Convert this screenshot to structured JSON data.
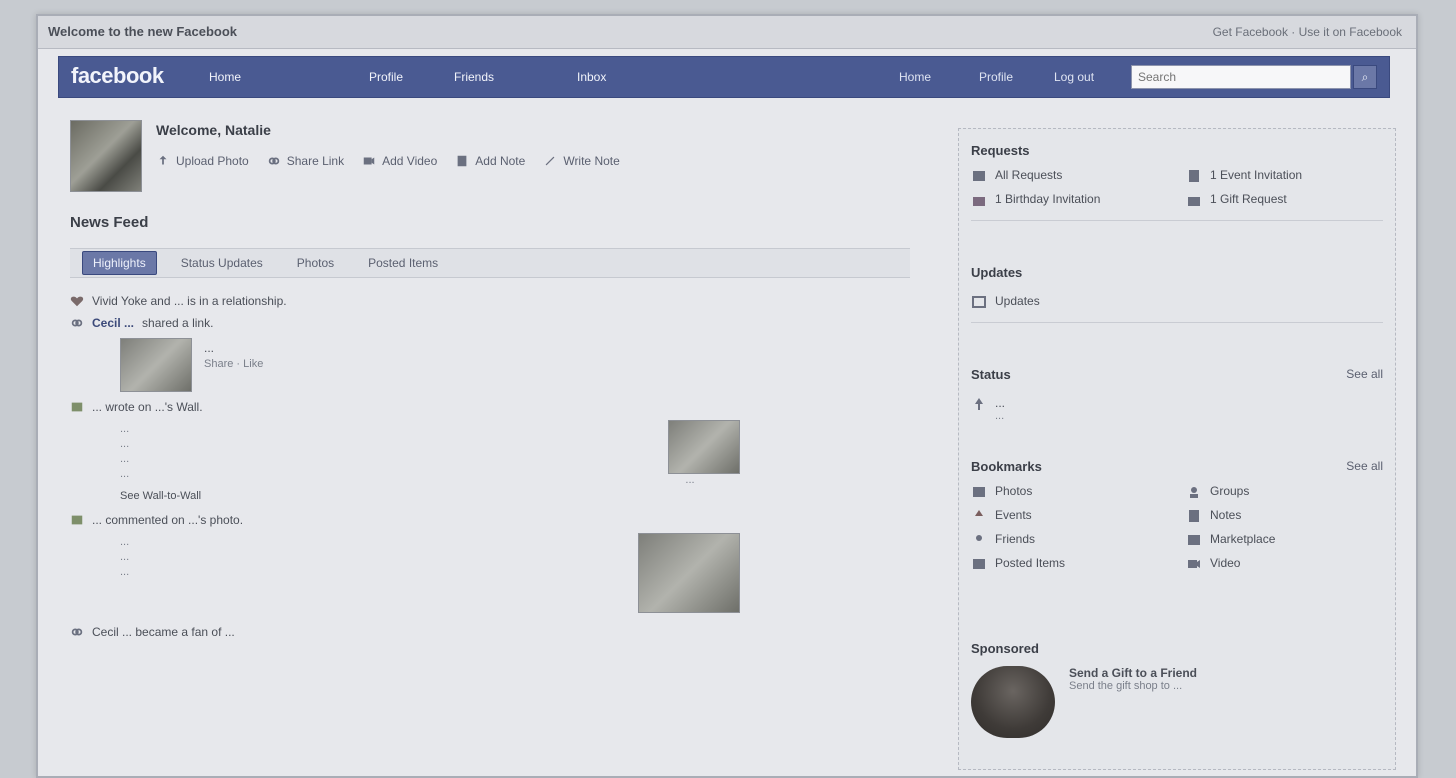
{
  "window": {
    "title": "Welcome to the new Facebook",
    "right_text": "Get Facebook · Use it on Facebook"
  },
  "topnav": {
    "logo": "facebook",
    "links": [
      "Home",
      "Profile",
      "Friends",
      "Inbox"
    ],
    "right_links": [
      "Home",
      "Profile",
      "Log out"
    ],
    "search_placeholder": "Search",
    "search_icon": "search-icon"
  },
  "profile": {
    "welcome": "Welcome, Natalie",
    "actions": [
      {
        "label": "Upload Photo",
        "icon": "upload-icon"
      },
      {
        "label": "Share Link",
        "icon": "link-icon"
      },
      {
        "label": "Add Video",
        "icon": "video-icon"
      },
      {
        "label": "Add Note",
        "icon": "note-icon"
      },
      {
        "label": "Write Note",
        "icon": "write-icon"
      }
    ]
  },
  "news_feed": {
    "title": "News Feed",
    "tabs": [
      "Highlights",
      "Status Updates",
      "Photos",
      "Posted Items"
    ],
    "active_tab_index": 0,
    "stories": [
      {
        "type": "relationship",
        "icon": "heart-icon",
        "text": "Vivid Yoke and ... is in a relationship."
      },
      {
        "type": "share",
        "icon": "link-icon",
        "actor": "Cecil ...",
        "text": "shared a link.",
        "attachment_title": "...",
        "attachment_sub": "Share · Like"
      },
      {
        "type": "wall",
        "icon": "wall-icon",
        "text": "... wrote on ...'s Wall.",
        "preview_lines": [
          "...",
          "...",
          "...",
          "..."
        ],
        "action": "See Wall-to-Wall",
        "thumb_caption": "..."
      },
      {
        "type": "photo",
        "icon": "photo-icon",
        "text": "... commented on ...'s photo.",
        "preview_lines": [
          "...",
          "...",
          "..."
        ]
      },
      {
        "type": "event",
        "icon": "link-icon",
        "text": "Cecil ... became a fan of ..."
      }
    ]
  },
  "sidebar": {
    "requests": {
      "title": "Requests",
      "items": [
        {
          "label": "All Requests",
          "icon": "requests-icon"
        },
        {
          "label": "1 Event Invitation",
          "icon": "event-icon"
        },
        {
          "label": "1 Birthday Invitation",
          "icon": "birthday-icon"
        },
        {
          "label": "1 Gift Request",
          "icon": "gift-icon"
        }
      ]
    },
    "updates": {
      "title": "Updates",
      "items": [
        {
          "label": "Updates",
          "icon": "updates-icon"
        }
      ]
    },
    "status": {
      "title": "Status",
      "see_all": "See all",
      "items": [
        {
          "label": "...",
          "sub": "...",
          "icon": "status-icon"
        }
      ]
    },
    "bookmarks": {
      "title": "Bookmarks",
      "see_all": "See all",
      "items": [
        {
          "label": "Photos",
          "icon": "photos-icon"
        },
        {
          "label": "Groups",
          "icon": "groups-icon"
        },
        {
          "label": "Events",
          "icon": "events-icon"
        },
        {
          "label": "Notes",
          "icon": "notes-icon"
        },
        {
          "label": "Friends",
          "icon": "friends-icon"
        },
        {
          "label": "Marketplace",
          "icon": "marketplace-icon"
        },
        {
          "label": "Posted Items",
          "icon": "posted-icon"
        },
        {
          "label": "Video",
          "icon": "video-icon"
        }
      ]
    },
    "sponsored": {
      "title": "Sponsored",
      "headline": "Send a Gift to a Friend",
      "body": "Send the gift shop to ..."
    }
  },
  "colors": {
    "facebook_blue": "#4a5a92",
    "page_bg": "#e7e8ec"
  }
}
